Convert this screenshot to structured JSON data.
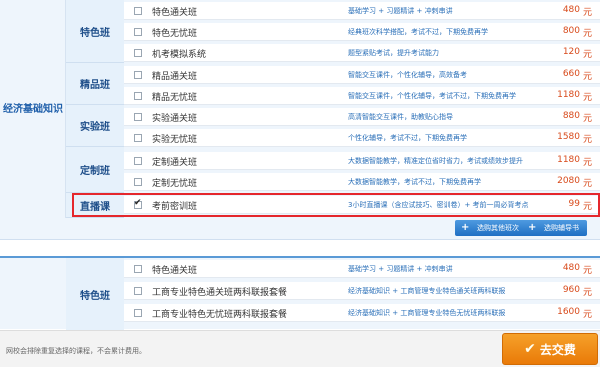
{
  "section1": {
    "subject": "经济基础知识",
    "categories": [
      {
        "label": "特色班"
      },
      {
        "label": "精品班"
      },
      {
        "label": "实验班"
      },
      {
        "label": "定制班"
      },
      {
        "label": "直播课"
      }
    ],
    "rows": [
      {
        "name": "特色通关班",
        "desc": "基础学习 + 习题精讲 + 冲刺串讲",
        "price": "480",
        "unit": "元"
      },
      {
        "name": "特色无忧班",
        "desc": "经典班次科学搭配，考试不过，下期免费再学",
        "price": "800",
        "unit": "元"
      },
      {
        "name": "机考模拟系统",
        "desc": "题型紧贴考试，提升考试能力",
        "price": "120",
        "unit": "元"
      },
      {
        "name": "精品通关班",
        "desc": "智能交互课件，个性化辅导，高效备考",
        "price": "660",
        "unit": "元"
      },
      {
        "name": "精品无忧班",
        "desc": "智能交互课件，个性化辅导，考试不过，下期免费再学",
        "price": "1180",
        "unit": "元"
      },
      {
        "name": "实验通关班",
        "desc": "高清智能交互课件，助教贴心指导",
        "price": "880",
        "unit": "元"
      },
      {
        "name": "实验无忧班",
        "desc": "个性化辅导，考试不过，下期免费再学",
        "price": "1580",
        "unit": "元"
      },
      {
        "name": "定制通关班",
        "desc": "大数据智能教学，精准定位省时省力，考试或绩效步提升",
        "price": "1180",
        "unit": "元"
      },
      {
        "name": "定制无忧班",
        "desc": "大数据智能教学，考试不过，下期免费再学",
        "price": "2080",
        "unit": "元"
      },
      {
        "name": "考前密训班",
        "desc": "3小时直播课（含应试技巧、密训卷）+ 考前一周必背考点",
        "price": "99",
        "unit": "元",
        "checked": true
      }
    ],
    "buttons": {
      "other": "选购其他班次",
      "tutoring": "选购辅导书"
    }
  },
  "section2": {
    "category": "特色班",
    "rows": [
      {
        "name": "特色通关班",
        "desc": "基础学习 + 习题精讲 + 冲刺串讲",
        "price": "480",
        "unit": "元"
      },
      {
        "name": "工商专业特色通关班两科联报套餐",
        "desc": "经济基础知识 + 工商管理专业特色通关班两科联报",
        "price": "960",
        "unit": "元"
      },
      {
        "name": "工商专业特色无忧班两科联报套餐",
        "desc": "经济基础知识 + 工商管理专业特色无忧班两科联报",
        "price": "1600",
        "unit": "元"
      }
    ]
  },
  "footer": {
    "note": "网校会排除重复选择的课程，不会累计费用。",
    "checkout": "去交费"
  },
  "colors": {
    "accent_blue": "#2a6fb8",
    "price_red": "#d84a1b",
    "highlight_red": "#e5272c",
    "checkout_orange": "#f08a16"
  },
  "icons": {
    "checkbox": "checkbox-icon",
    "plus": "plus-icon",
    "check": "check-icon"
  }
}
